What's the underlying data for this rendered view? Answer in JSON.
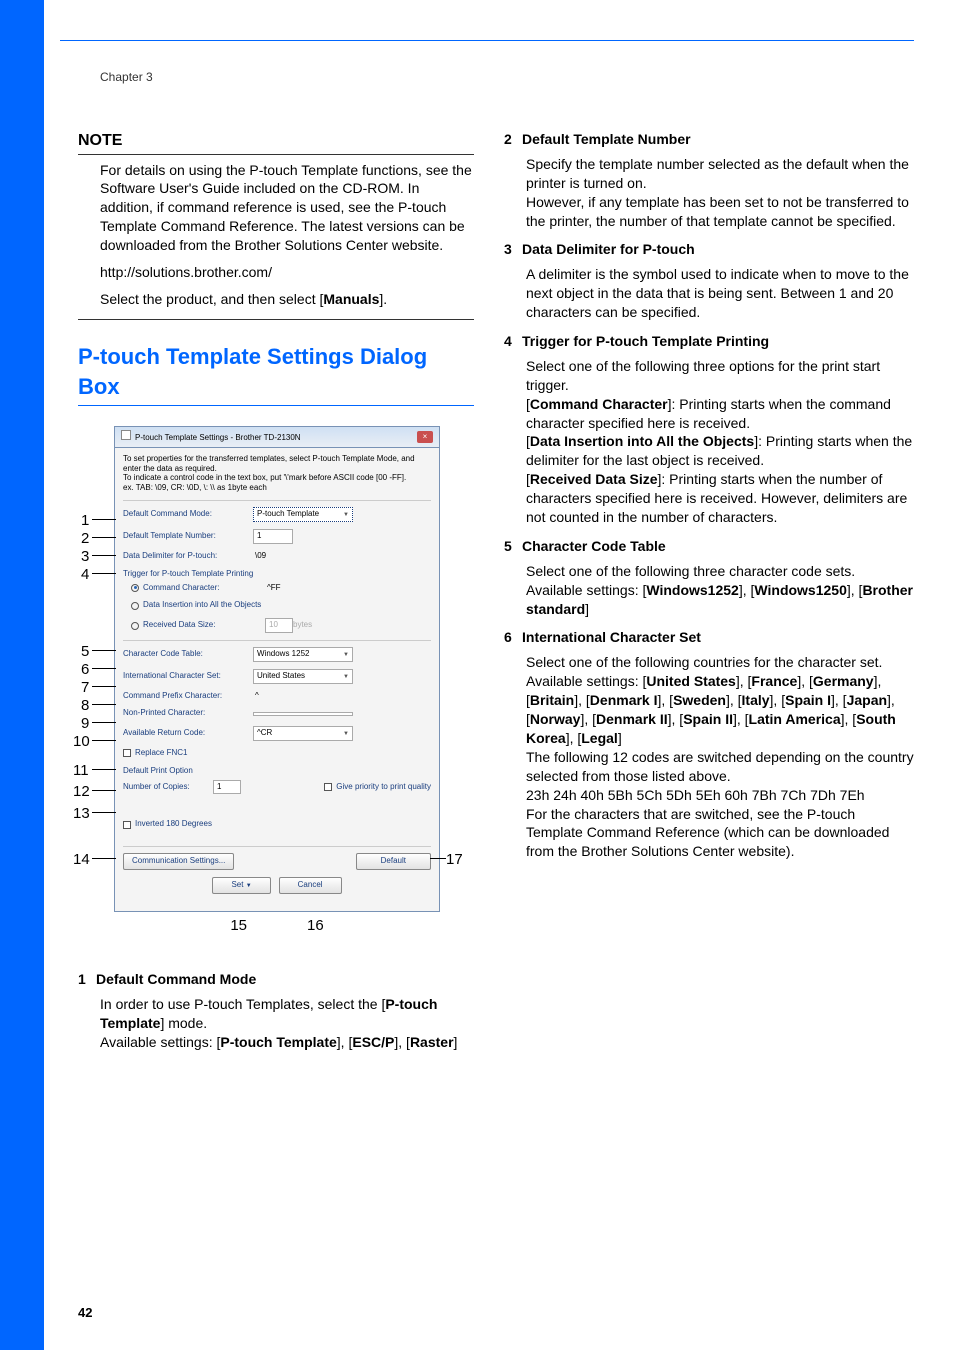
{
  "chapter": "Chapter 3",
  "note": {
    "heading": "NOTE",
    "p1": "For details on using the P-touch Template functions, see the Software User's Guide included on the CD-ROM. In addition, if command reference is used, see the P-touch Template Command Reference. The latest versions can be downloaded from the Brother Solutions Center website.",
    "p2": "http://solutions.brother.com/",
    "p3a": "Select the product, and then select [",
    "p3b": "Manuals",
    "p3c": "]."
  },
  "h2a": "P-touch Template Settings Dialog Box",
  "dialog": {
    "title": "P-touch Template Settings - Brother TD-2130N",
    "intro1": "To set properties for the transferred templates, select P-touch Template Mode, and enter the data as required.",
    "intro2": "To indicate a control code in the text box, put '\\'mark before ASCII code [00 -FF].",
    "intro3": "ex. TAB: \\09,  CR: \\0D,  \\: \\\\  as 1byte each",
    "r1_label": "Default Command Mode:",
    "r1_value": "P-touch Template",
    "r2_label": "Default Template Number:",
    "r2_value": "1",
    "r3_label": "Data Delimiter for P-touch:",
    "r3_value": "\\09",
    "r4_group": "Trigger for P-touch Template Printing",
    "r4a_label": "Command Character:",
    "r4a_value": "^FF",
    "r4b_label": "Data Insertion into All the Objects",
    "r4c_label": "Received Data Size:",
    "r4c_value": "10",
    "r4c_unit": "bytes",
    "r5_label": "Character Code Table:",
    "r5_value": "Windows 1252",
    "r6_label": "International Character Set:",
    "r6_value": "United States",
    "r7_label": "Command Prefix Character:",
    "r7_value": "^",
    "r8_label": "Non-Printed Character:",
    "r9_label": "Available Return Code:",
    "r9_value": "^CR",
    "r10_label": "Replace FNC1",
    "dpo": "Default Print Option",
    "r11_label": "Number of Copies:",
    "r11_value": "1",
    "r11_chk": "Give priority to print quality",
    "r13_label": "Inverted 180 Degrees",
    "btn_comm": "Communication Settings...",
    "btn_default": "Default",
    "btn_set": "Set",
    "btn_cancel": "Cancel"
  },
  "callouts": {
    "c1": "1",
    "c2": "2",
    "c3": "3",
    "c4": "4",
    "c5": "5",
    "c6": "6",
    "c7": "7",
    "c8": "8",
    "c9": "9",
    "c10": "10",
    "c11": "11",
    "c12": "12",
    "c13": "13",
    "c14": "14",
    "c15": "15",
    "c16": "16",
    "c17": "17"
  },
  "items": {
    "i1t": "Default Command Mode",
    "i1a": "In order to use P-touch Templates, select the [",
    "i1b": "P-touch Template",
    "i1c": "] mode.",
    "i1d": "Available settings: [",
    "i1e": "P-touch Template",
    "i1f": "], [",
    "i1g": "ESC/P",
    "i1h": "], [",
    "i1i": "Raster",
    "i1j": "]",
    "i2t": "Default Template Number",
    "i2a": "Specify the template number selected as the default when the printer is turned on.",
    "i2b": "However, if any template has been set to not be transferred to the printer, the number of that template cannot be specified.",
    "i3t": "Data Delimiter for P-touch",
    "i3a": "A delimiter is the symbol used to indicate when to move to the next object in the data that is being sent. Between 1 and 20 characters can be specified.",
    "i4t": "Trigger for P-touch Template Printing",
    "i4a": "Select one of the following three options for the print start trigger.",
    "i4b1": "[",
    "i4b2": "Command Character",
    "i4b3": "]: Printing starts when the command character specified here is received.",
    "i4c1": "[",
    "i4c2": "Data Insertion into All the Objects",
    "i4c3": "]: Printing starts when the delimiter for the last object is received.",
    "i4d1": "[",
    "i4d2": "Received Data Size",
    "i4d3": "]: Printing starts when the number of characters specified here is received. However, delimiters are not counted in the number of characters.",
    "i5t": "Character Code Table",
    "i5a": "Select one of the following three character code sets.",
    "i5b1": "Available settings: [",
    "i5b2": "Windows1252",
    "i5b3": "], [",
    "i5b4": "Windows1250",
    "i5b5": "], [",
    "i5b6": "Brother standard",
    "i5b7": "]",
    "i6t": "International Character Set",
    "i6a": "Select one of the following countries for the character set.",
    "i6b1": "Available settings: [",
    "i6b2": "United States",
    "i6b3": "], [",
    "i6b4": "France",
    "i6b5": "], [",
    "i6b6": "Germany",
    "i6b7": "], [",
    "i6b8": "Britain",
    "i6b9": "], [",
    "i6b10": "Denmark I",
    "i6b11": "], [",
    "i6b12": "Sweden",
    "i6b13": "], [",
    "i6b14": "Italy",
    "i6b15": "], [",
    "i6b16": "Spain I",
    "i6b17": "], [",
    "i6b18": "Japan",
    "i6b19": "], [",
    "i6b20": "Norway",
    "i6b21": "], [",
    "i6b22": "Denmark II",
    "i6b23": "], [",
    "i6b24": "Spain II",
    "i6b25": "], [",
    "i6b26": "Latin America",
    "i6b27": "], [",
    "i6b28": "South Korea",
    "i6b29": "], [",
    "i6b30": "Legal",
    "i6b31": "]",
    "i6c": "The following 12 codes are switched depending on the country selected from those listed above.",
    "i6d": "23h 24h 40h 5Bh 5Ch 5Dh 5Eh 60h 7Bh 7Ch 7Dh 7Eh",
    "i6e": "For the characters that are switched, see the P-touch Template Command Reference (which can be downloaded from the Brother Solutions Center website)."
  },
  "page": "42"
}
